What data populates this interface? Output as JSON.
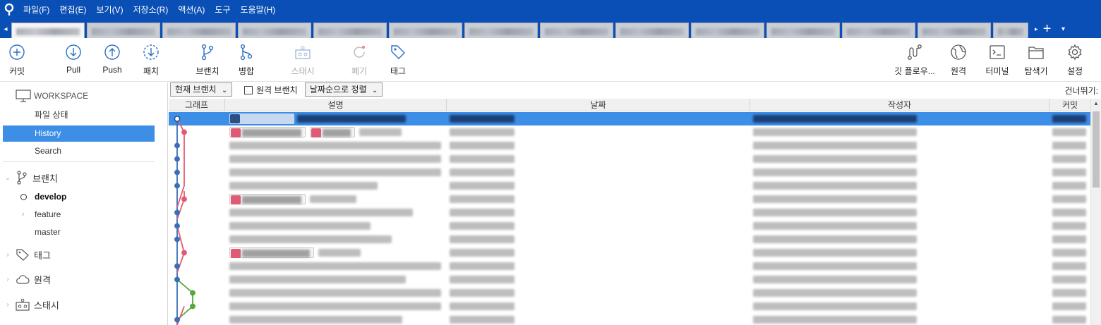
{
  "menu": {
    "logo_icon": "sourcetree-logo-icon",
    "items": [
      "파일(F)",
      "편집(E)",
      "보기(V)",
      "저장소(R)",
      "액션(A)",
      "도구",
      "도움말(H)"
    ]
  },
  "tabs": {
    "count_visible": 14,
    "active_index": 0,
    "left_arrow": "◂",
    "overflow_arrow": "▸",
    "add": "+",
    "dropdown": "▾"
  },
  "toolbar": {
    "left": [
      {
        "label": "커밋",
        "icon": "commit-plus-icon",
        "enabled": true
      },
      {
        "label": "Pull",
        "icon": "pull-arrow-down-icon",
        "enabled": true
      },
      {
        "label": "Push",
        "icon": "push-arrow-up-icon",
        "enabled": true
      },
      {
        "label": "패치",
        "icon": "fetch-dashed-arrow-icon",
        "enabled": true
      },
      {
        "label": "브랜치",
        "icon": "branch-icon",
        "enabled": true
      },
      {
        "label": "병합",
        "icon": "merge-icon",
        "enabled": true
      },
      {
        "label": "스태시",
        "icon": "stash-icon",
        "enabled": false
      },
      {
        "label": "폐기",
        "icon": "discard-icon",
        "enabled": false
      },
      {
        "label": "태그",
        "icon": "tag-icon",
        "enabled": true
      }
    ],
    "right": [
      {
        "label": "깃 플로우...",
        "icon": "git-flow-icon"
      },
      {
        "label": "원격",
        "icon": "globe-icon"
      },
      {
        "label": "터미널",
        "icon": "terminal-icon"
      },
      {
        "label": "탐색기",
        "icon": "explorer-folder-icon"
      },
      {
        "label": "설정",
        "icon": "gear-icon"
      }
    ]
  },
  "sidebar": {
    "workspace_label": "WORKSPACE",
    "workspace_items": [
      "파일 상태",
      "History",
      "Search"
    ],
    "selected_item": "History",
    "branches_label": "브랜치",
    "branches": [
      {
        "name": "develop",
        "current": true,
        "expandable": false
      },
      {
        "name": "feature",
        "current": false,
        "expandable": true
      },
      {
        "name": "master",
        "current": false,
        "expandable": false
      }
    ],
    "tags_label": "태그",
    "remotes_label": "원격",
    "stashes_label": "스태시"
  },
  "filters": {
    "branch_filter": "현재 브랜치",
    "remote_branches_label": "원격 브랜치",
    "remote_branches_checked": false,
    "sort": "날짜순으로 정렬",
    "skip_label": "건너뛰기:"
  },
  "table": {
    "columns": [
      "그래프",
      "설명",
      "날짜",
      "작성자",
      "커밋"
    ],
    "row_count_visible": 16,
    "selected_row": 0
  },
  "colors": {
    "title_bar": "#0a4fb5",
    "selection": "#3d8ee6",
    "graph_blue": "#3a6fb8",
    "graph_pink": "#e05a75",
    "graph_green": "#56a83a"
  }
}
